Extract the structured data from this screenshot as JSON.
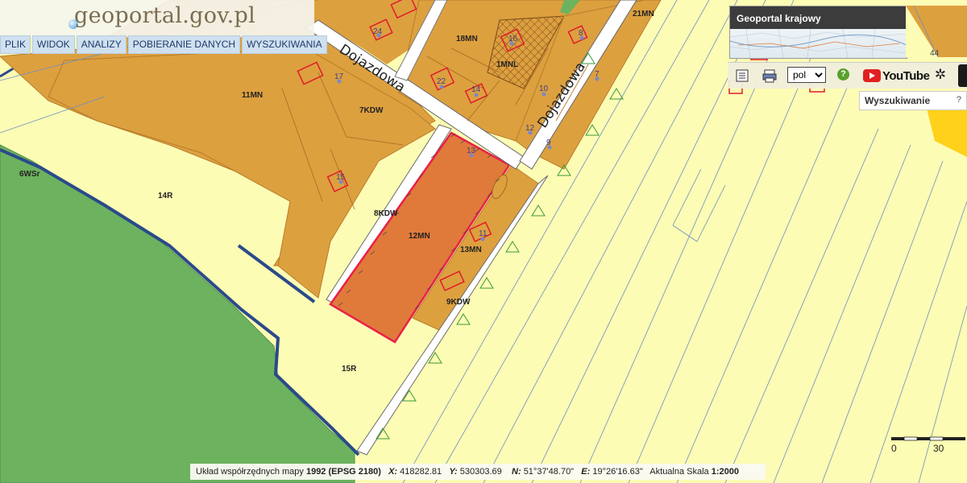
{
  "logo": {
    "text": "geoportal.gov.pl"
  },
  "menu": [
    {
      "label": "PLIK"
    },
    {
      "label": "WIDOK"
    },
    {
      "label": "ANALIZY"
    },
    {
      "label": "POBIERANIE DANYCH"
    },
    {
      "label": "WYSZUKIWANIA"
    }
  ],
  "kraj_panel": {
    "title": "Geoportal krajowy"
  },
  "toolbar": {
    "language": "pol",
    "help": "?",
    "youtube": "YouTube"
  },
  "search_panel": {
    "title": "Wyszukiwanie",
    "help": "?"
  },
  "map": {
    "roads": [
      "Dojazdowa",
      "Dojazdowa"
    ],
    "zones": [
      "11MN",
      "18MN",
      "1MNL",
      "21MN",
      "7KDW",
      "8KDW",
      "12MN",
      "13MN",
      "9KDW",
      "14R",
      "15R",
      "6WSr"
    ],
    "lot_numbers": [
      "24",
      "16",
      "8",
      "17",
      "22",
      "14",
      "10",
      "7",
      "12",
      "9",
      "13",
      "15",
      "11"
    ]
  },
  "scalebar": {
    "zero": "0",
    "mid": "30"
  },
  "status": {
    "crs_label": "Układ współrzędnych mapy",
    "crs_value": "1992 (EPSG 2180)",
    "x_label": "X:",
    "x_value": "418282.81",
    "y_label": "Y:",
    "y_value": "530303.69",
    "n_label": "N:",
    "n_value": "51°37'48.70\"",
    "e_label": "E:",
    "e_value": "19°26'16.63\"",
    "scale_label": "Aktualna Skala",
    "scale_value": "1:2000"
  },
  "colors": {
    "residential": "#dda03f",
    "agricultural": "#fdfcb4",
    "forest": "#6db25f",
    "highlight": "#e07a3a",
    "highlight_border": "#e8204a",
    "road": "#ffffff",
    "water": "#2a4a8a"
  }
}
